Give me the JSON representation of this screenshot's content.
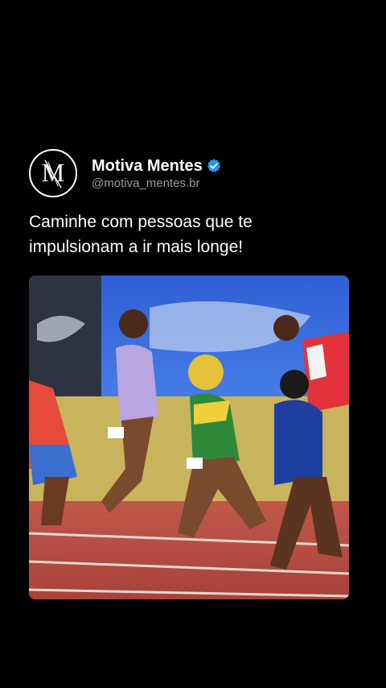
{
  "post": {
    "display_name": "Motiva Mentes",
    "handle": "@motiva_mentes.br",
    "text": "Caminhe com pessoas que te impulsionam a ir mais longe!",
    "avatar_icon": "mm-monogram-logo",
    "verified_icon": "verified-badge-icon",
    "verified_color": "#1d9bf0"
  },
  "media": {
    "icon": "race-video-thumbnail"
  },
  "colors": {
    "background": "#000000",
    "text": "#ffffff",
    "handle": "#9a9a9a"
  }
}
